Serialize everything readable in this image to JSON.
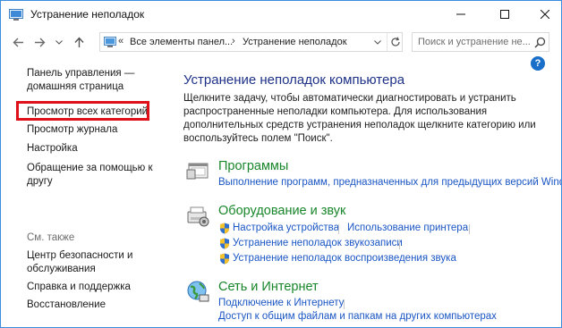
{
  "window": {
    "title": "Устранение неполадок"
  },
  "address": {
    "chevron": "«",
    "segments": [
      "Все элементы панел...",
      "Устранение неполадок"
    ],
    "separator": "›"
  },
  "search": {
    "placeholder": "Поиск и устранение не..."
  },
  "help": {
    "label": "?"
  },
  "left_pane": {
    "home_line1": "Панель управления —",
    "home_line2": "домашняя страница",
    "view_all": "Просмотр всех категорий",
    "history": "Просмотр журнала",
    "settings": "Настройка",
    "get_help_line1": "Обращение за помощью к",
    "get_help_line2": "другу",
    "see_also": "См. также",
    "security_line1": "Центр безопасности и",
    "security_line2": "обслуживания",
    "help_support": "Справка и поддержка",
    "recovery": "Восстановление"
  },
  "main": {
    "title": "Устранение неполадок компьютера",
    "desc_lines": [
      "Щелкните задачу, чтобы автоматически диагностировать и устранить",
      "распространенные неполадки компьютера. Для использования",
      "дополнительных средств устранения неполадок щелкните категорию или",
      "воспользуйтесь полем \"Поиск\"."
    ],
    "categories": [
      {
        "title": "Программы",
        "icon": "programs-icon",
        "links": [
          "Выполнение программ, предназначенных для предыдущих версий Windows"
        ]
      },
      {
        "title": "Оборудование и звук",
        "icon": "hardware-sound-icon",
        "links": [
          "Настройка устройства",
          "Использование принтера",
          "Устранение неполадок звукозаписи",
          "Устранение неполадок воспроизведения звука"
        ]
      },
      {
        "title": "Сеть и Интернет",
        "icon": "network-icon",
        "links": [
          "Подключение к Интернету",
          "Доступ к общим файлам и папкам на других компьютерах"
        ]
      }
    ]
  },
  "colors": {
    "window_border": "#3b8de0",
    "heading_blue": "#1e3287",
    "category_green": "#18862a",
    "link_blue": "#1a56c4",
    "highlight_red": "#e0101a"
  }
}
